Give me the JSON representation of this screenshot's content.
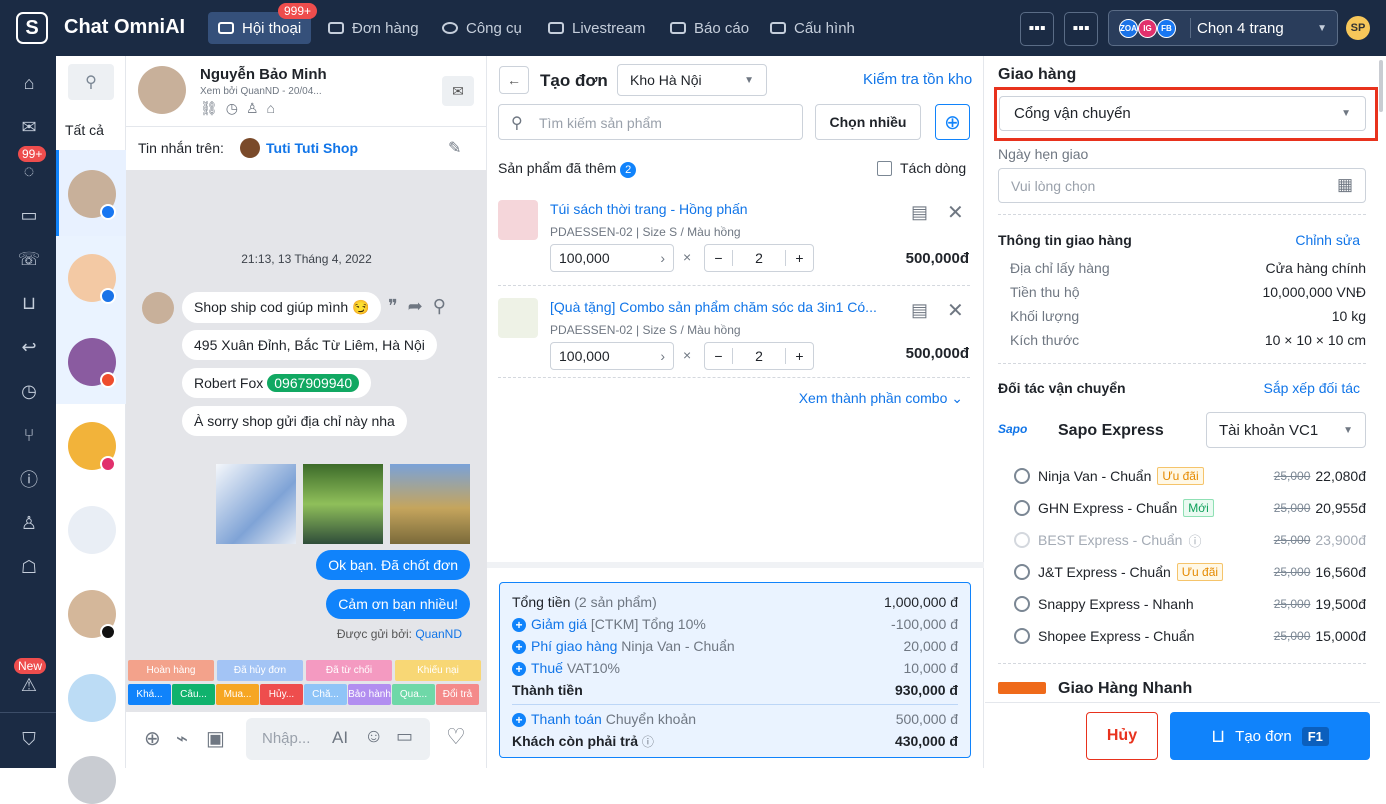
{
  "app": {
    "title": "Chat OmniAI",
    "logo": "S"
  },
  "nav": [
    {
      "label": "Hội thoại",
      "badge": "999+"
    },
    {
      "label": "Đơn hàng"
    },
    {
      "label": "Công cụ"
    },
    {
      "label": "Livestream"
    },
    {
      "label": "Báo cáo"
    },
    {
      "label": "Cấu hình"
    }
  ],
  "page_selector": {
    "label": "Chọn 4 trang",
    "icons": [
      "ZOA",
      "IG",
      "FB"
    ]
  },
  "user_avatar": "SP",
  "leftbar": {
    "badge_messenger": "99+",
    "badge_new": "New"
  },
  "conv_list": {
    "tab_all": "Tất cả"
  },
  "chat": {
    "customer_name": "Nguyễn Bảo Minh",
    "seen_by": "Xem bởi QuanND - 20/04...",
    "msg_on_label": "Tin nhắn trên:",
    "shop_name": "Tuti Tuti Shop",
    "timestamp": "21:13, 13 Tháng 4, 2022",
    "messages": [
      "Shop ship cod giúp mình 😏",
      "495 Xuân Đỉnh, Bắc Từ Liêm, Hà Nội",
      "Robert Fox",
      "À sorry shop gửi địa chỉ này nha"
    ],
    "phone": "0967909940",
    "my_messages": [
      "Ok bạn. Đã chốt đơn",
      "Cảm ơn bạn nhiều!"
    ],
    "sent_by_label": "Được gửi bởi:",
    "sent_by": "QuanND",
    "tags_top": [
      "Hoàn hàng",
      "Đã hủy đơn",
      "Đã từ chối",
      "Khiếu nại"
    ],
    "tags_bottom": [
      "Khá...",
      "Câu...",
      "Mua...",
      "Hủy...",
      "Chă...",
      "Bảo hành",
      "Qua...",
      "Đổi trả"
    ],
    "input_placeholder": "Nhập...",
    "ai_label": "AI"
  },
  "order": {
    "title": "Tạo đơn",
    "warehouse": "Kho Hà Nội",
    "check_stock": "Kiểm tra tồn kho",
    "search_placeholder": "Tìm kiếm sản phẩm",
    "choose_many": "Chọn nhiều",
    "added_label": "Sản phẩm đã thêm",
    "added_count": "2",
    "split_line": "Tách dòng",
    "products": [
      {
        "name": "Túi sách thời trang - Hồng phấn",
        "sku": "PDAESSEN-02 | Size S / Màu hồng",
        "price": "100,000",
        "qty": "2",
        "total": "500,000đ"
      },
      {
        "name": "[Quà tặng] Combo sản phẩm chăm sóc da 3in1 Có...",
        "sku": "PDAESSEN-02 | Size S / Màu hồng",
        "price": "100,000",
        "qty": "2",
        "total": "500,000đ"
      }
    ],
    "combo_link": "Xem thành phần combo",
    "summary": {
      "total_label": "Tổng tiền",
      "total_count": "(2 sản phẩm)",
      "total_value": "1,000,000 đ",
      "discount_label": "Giảm giá",
      "discount_note": "[CTKM] Tổng 10%",
      "discount_value": "-100,000 đ",
      "ship_label": "Phí giao hàng",
      "ship_note": "Ninja Van - Chuẩn",
      "ship_value": "20,000 đ",
      "tax_label": "Thuế",
      "tax_note": "VAT10%",
      "tax_value": "10,000 đ",
      "grand_label": "Thành tiền",
      "grand_value": "930,000 đ",
      "pay_label": "Thanh toán",
      "pay_note": "Chuyển khoản",
      "pay_value": "500,000 đ",
      "remain_label": "Khách còn phải trả",
      "remain_value": "430,000 đ"
    }
  },
  "shipping": {
    "title": "Giao hàng",
    "gateway": "Cổng vận chuyển",
    "date_label": "Ngày hẹn giao",
    "date_placeholder": "Vui lòng chọn",
    "info_title": "Thông tin giao hàng",
    "edit": "Chỉnh sửa",
    "info": [
      {
        "k": "Địa chỉ lấy hàng",
        "v": "Cửa hàng chính"
      },
      {
        "k": "Tiền thu hộ",
        "v": "10,000,000 VNĐ"
      },
      {
        "k": "Khối lượng",
        "v": "10 kg"
      },
      {
        "k": "Kích thước",
        "v": "10 × 10 × 10 cm"
      }
    ],
    "partners_title": "Đối tác vận chuyển",
    "sort": "Sắp xếp đối tác",
    "sapo": {
      "logo": "Sapo",
      "name": "Sapo Express",
      "account": "Tài khoản VC1"
    },
    "carriers": [
      {
        "name": "Ninja Van - Chuẩn",
        "tag": "Ưu đãi",
        "old": "25,000",
        "price": "22,080đ"
      },
      {
        "name": "GHN Express - Chuẩn",
        "tag": "Mới",
        "old": "25,000",
        "price": "20,955đ"
      },
      {
        "name": "BEST Express - Chuẩn",
        "tag": "",
        "old": "25,000",
        "price": "23,900đ"
      },
      {
        "name": "J&T Express - Chuẩn",
        "tag": "Ưu đãi",
        "old": "25,000",
        "price": "16,560đ"
      },
      {
        "name": "Snappy Express - Nhanh",
        "tag": "",
        "old": "25,000",
        "price": "19,500đ"
      },
      {
        "name": "Shopee Express - Chuẩn",
        "tag": "",
        "old": "25,000",
        "price": "15,000đ"
      }
    ],
    "ghn": {
      "name": "Giao Hàng Nhanh"
    },
    "cancel": "Hủy",
    "create": "Tạo đơn",
    "create_key": "F1"
  }
}
